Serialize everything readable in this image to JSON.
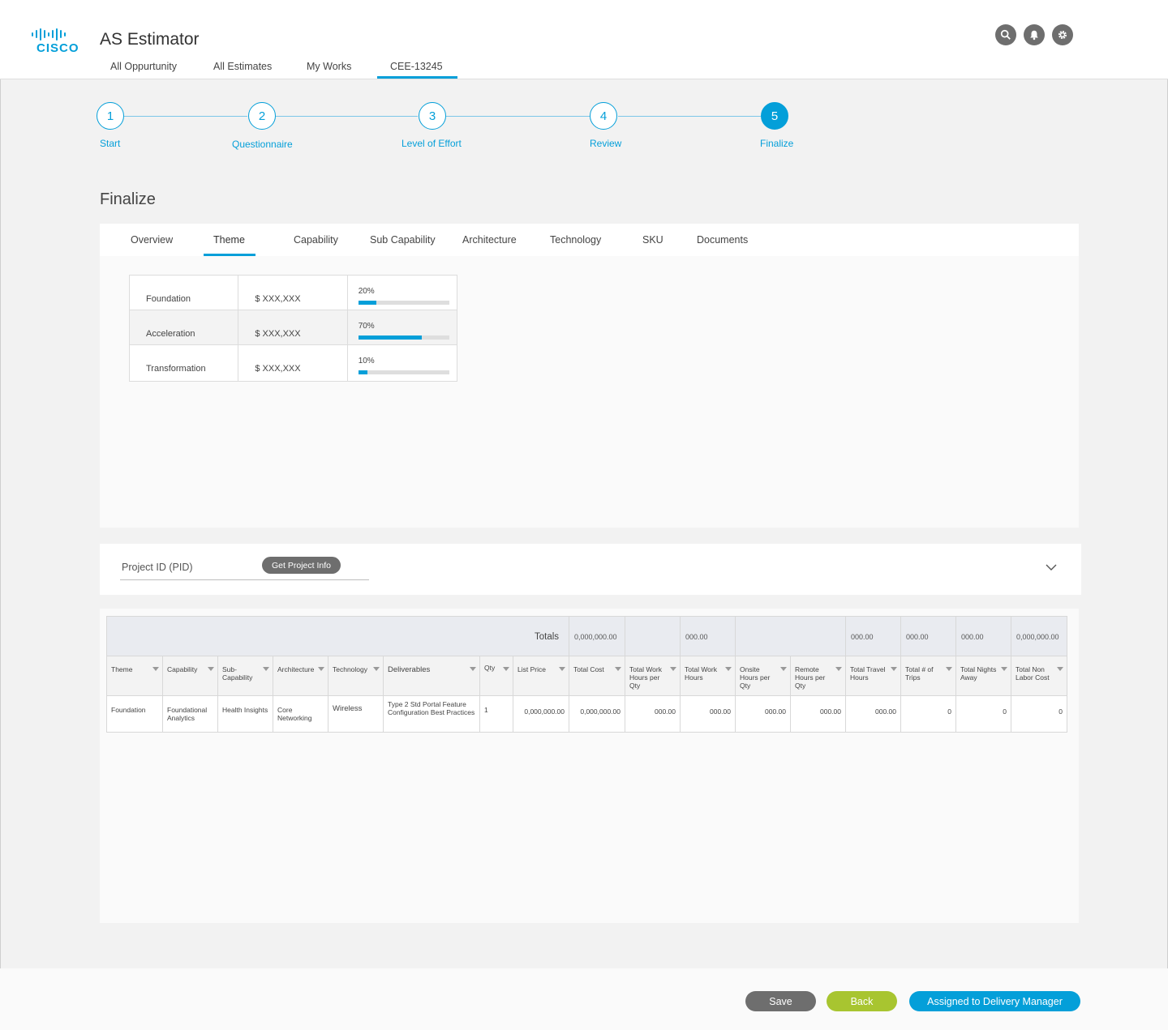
{
  "app": {
    "logo_text": "CISCO",
    "title": "AS Estimator"
  },
  "nav": {
    "items": [
      "All Oppurtunity",
      "All Estimates",
      "My Works",
      "CEE-13245"
    ],
    "active_index": 3
  },
  "header_icons": [
    "search-icon",
    "bell-icon",
    "gear-icon"
  ],
  "stepper": {
    "steps": [
      {
        "num": "1",
        "label": "Start"
      },
      {
        "num": "2",
        "label": "Questionnaire"
      },
      {
        "num": "3",
        "label": "Level of Effort"
      },
      {
        "num": "4",
        "label": "Review"
      },
      {
        "num": "5",
        "label": "Finalize"
      }
    ],
    "active_index": 4
  },
  "page": {
    "title": "Finalize"
  },
  "tabs": {
    "items": [
      "Overview",
      "Theme",
      "Capability",
      "Sub Capability",
      "Architecture",
      "Technology",
      "SKU",
      "Documents"
    ],
    "active_index": 1
  },
  "theme_table": {
    "rows": [
      {
        "name": "Foundation",
        "amount": "$ XXX,XXX",
        "pct_label": "20%",
        "pct": 0.2
      },
      {
        "name": "Acceleration",
        "amount": "$ XXX,XXX",
        "pct_label": "70%",
        "pct": 0.7
      },
      {
        "name": "Transformation",
        "amount": "$ XXX,XXX",
        "pct_label": "10%",
        "pct": 0.1
      }
    ]
  },
  "pid": {
    "label": "Project ID (PID)",
    "button": "Get Project Info"
  },
  "grid": {
    "totals_label": "Totals",
    "totals": [
      "0,000,000.00",
      "",
      "000.00",
      "",
      "",
      "000.00",
      "000.00",
      "000.00",
      "0,000,000.00"
    ],
    "headers": [
      "Theme",
      "Capability",
      "Sub-\nCapability",
      "Architecture",
      "Technology",
      "Deliverables",
      "Qty",
      "List Price",
      "Total Cost",
      "Total Work Hours per Qty",
      "Total Work Hours",
      "Onsite Hours per Qty",
      "Remote Hours per Qty",
      "Total Travel Hours",
      "Total # of Trips",
      "Total Nights Away",
      "Total Non Labor Cost"
    ],
    "rows": [
      [
        "Foundation",
        "Foundational Analytics",
        "Health Insights",
        "Core Networking",
        "Wireless",
        "Type 2 Std Portal Feature Configuration Best Practices",
        "1",
        "0,000,000.00",
        "0,000,000.00",
        "000.00",
        "000.00",
        "000.00",
        "000.00",
        "000.00",
        "0",
        "0",
        "0"
      ]
    ]
  },
  "footer": {
    "save": "Save",
    "back": "Back",
    "assign": "Assigned to Delivery Manager"
  },
  "colors": {
    "accent": "#049fd9",
    "back_button": "#a8c530",
    "neutral_button": "#6e6e6e"
  }
}
